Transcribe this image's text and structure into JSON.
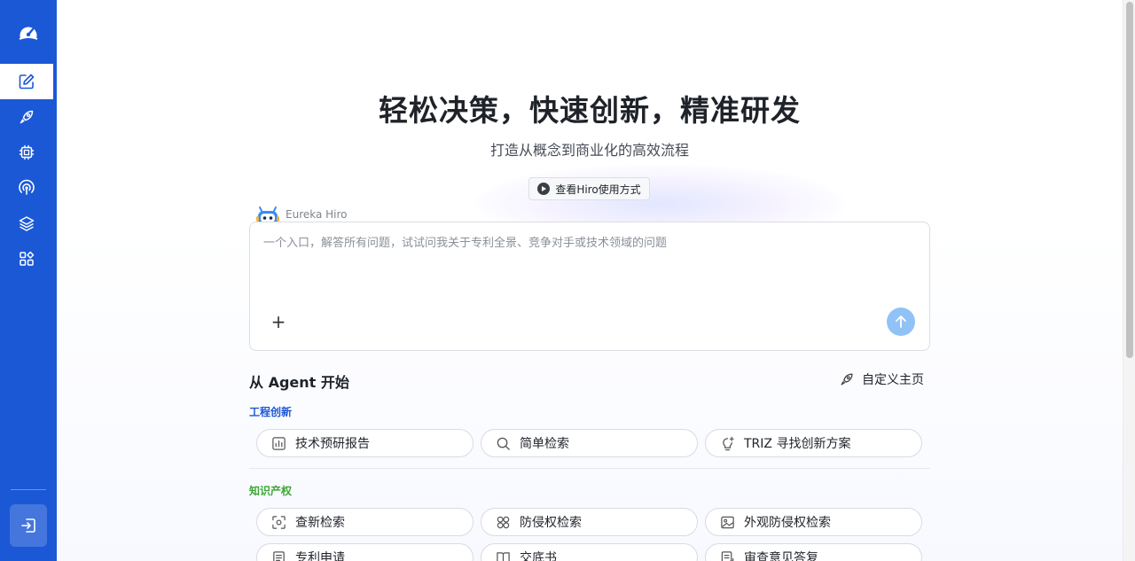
{
  "hero": {
    "title": "轻松决策，快速创新，精准研发",
    "subtitle": "打造从概念到商业化的高效流程",
    "video_button": "查看Hiro使用方式"
  },
  "assistant": {
    "name": "Eureka Hiro",
    "placeholder": "一个入口，解答所有问题，试试问我关于专利全景、竞争对手或技术领域的问题",
    "plus_label": "+"
  },
  "agents": {
    "heading": "从 Agent 开始",
    "customize_label": "自定义主页",
    "groups": [
      {
        "label": "工程创新",
        "color": "#1b58d6",
        "items": [
          {
            "label": "技术预研报告",
            "icon": "report-icon"
          },
          {
            "label": "简单检索",
            "icon": "search-icon"
          },
          {
            "label": "TRIZ 寻找创新方案",
            "icon": "idea-icon"
          }
        ]
      },
      {
        "label": "知识产权",
        "color": "#3da632",
        "items": [
          {
            "label": "查新检索",
            "icon": "scan-icon"
          },
          {
            "label": "防侵权检索",
            "icon": "link-icon"
          },
          {
            "label": "外观防侵权检索",
            "icon": "image-icon"
          },
          {
            "label": "专利申请",
            "icon": "document-icon"
          },
          {
            "label": "交底书",
            "icon": "book-icon"
          },
          {
            "label": "审查意见答复",
            "icon": "reply-icon"
          }
        ]
      }
    ]
  },
  "sidebar": {
    "items": [
      {
        "icon": "edit-icon",
        "active": true
      },
      {
        "icon": "rocket-icon",
        "active": false
      },
      {
        "icon": "chip-icon",
        "active": false
      },
      {
        "icon": "broadcast-icon",
        "active": false
      },
      {
        "icon": "layers-icon",
        "active": false
      },
      {
        "icon": "apps-icon",
        "active": false
      }
    ],
    "logout_icon": "logout-icon"
  },
  "colors": {
    "sidebar": "#1b58d6",
    "send_button": "#91c2f6",
    "engineering": "#1b58d6",
    "ip": "#3da632"
  }
}
